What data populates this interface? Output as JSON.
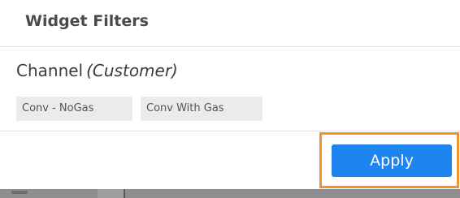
{
  "dialog": {
    "title": "Widget Filters"
  },
  "filter": {
    "label": "Channel",
    "sublabel": "(Customer)",
    "chips": [
      {
        "label": "Conv - NoGas"
      },
      {
        "label": "Conv With Gas"
      }
    ]
  },
  "actions": {
    "apply_label": "Apply"
  },
  "colors": {
    "accent": "#1e85f0",
    "highlight": "#f0932d",
    "chip_bg": "#ebebeb"
  }
}
